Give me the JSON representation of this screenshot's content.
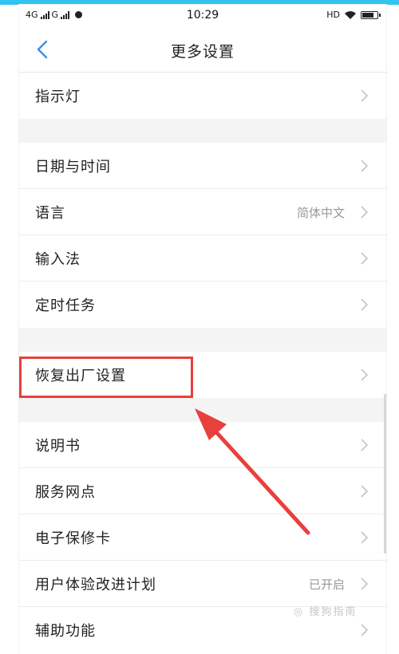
{
  "status_bar": {
    "left_text": "4G",
    "left_text2": "G",
    "time": "10:29",
    "hd": "HD"
  },
  "nav": {
    "title": "更多设置"
  },
  "sections": [
    {
      "items": [
        {
          "label": "指示灯",
          "value": ""
        }
      ]
    },
    {
      "items": [
        {
          "label": "日期与时间",
          "value": ""
        },
        {
          "label": "语言",
          "value": "简体中文"
        },
        {
          "label": "输入法",
          "value": ""
        },
        {
          "label": "定时任务",
          "value": ""
        }
      ]
    },
    {
      "items": [
        {
          "label": "恢复出厂设置",
          "value": ""
        }
      ]
    },
    {
      "items": [
        {
          "label": "说明书",
          "value": ""
        },
        {
          "label": "服务网点",
          "value": ""
        },
        {
          "label": "电子保修卡",
          "value": ""
        },
        {
          "label": "用户体验改进计划",
          "value": "已开启"
        },
        {
          "label": "辅助功能",
          "value": ""
        }
      ]
    }
  ],
  "annotation_color": "#e8403c",
  "watermark": "◎ 搜狗指南"
}
